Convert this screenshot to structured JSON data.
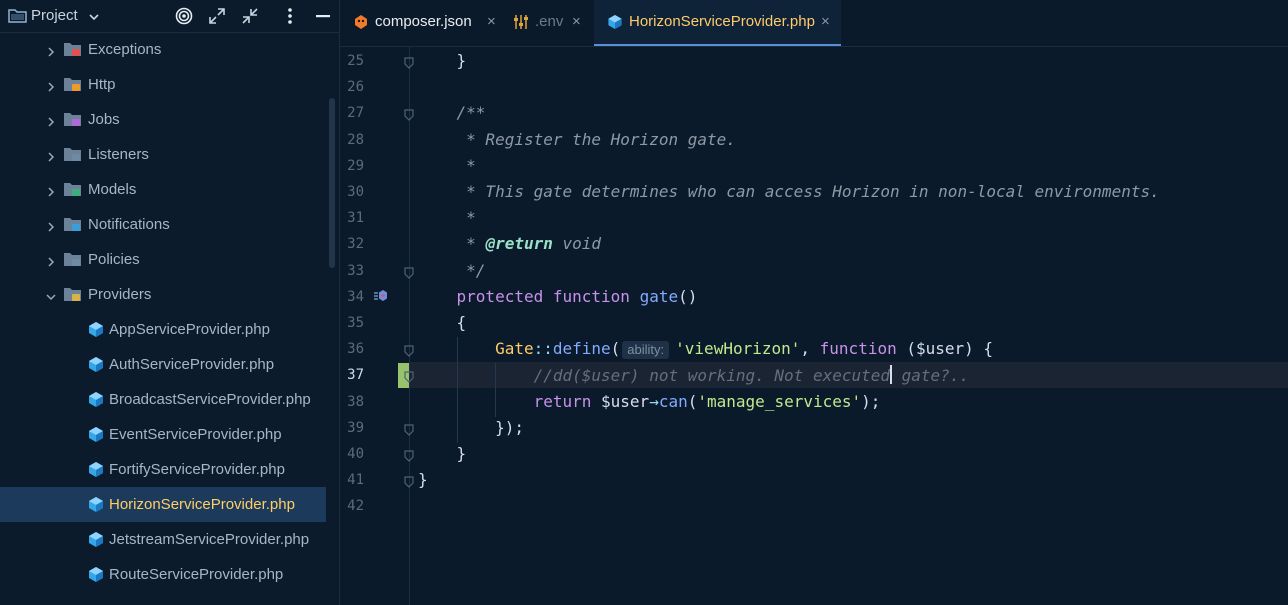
{
  "project_panel": {
    "title": "Project",
    "tree": [
      {
        "label": "Exceptions",
        "type": "folder",
        "color": "#e05252"
      },
      {
        "label": "Http",
        "type": "folder",
        "color": "#f09a2c"
      },
      {
        "label": "Jobs",
        "type": "folder",
        "color": "#b06ad6"
      },
      {
        "label": "Listeners",
        "type": "folder",
        "color": "#6f8aa3"
      },
      {
        "label": "Models",
        "type": "folder",
        "color": "#3fae7e"
      },
      {
        "label": "Notifications",
        "type": "folder",
        "color": "#3a9fd8"
      },
      {
        "label": "Policies",
        "type": "folder",
        "color": "#6f8aa3"
      },
      {
        "label": "Providers",
        "type": "folder-open",
        "color": "#d9b34a"
      },
      {
        "label": "AppServiceProvider.php",
        "type": "php"
      },
      {
        "label": "AuthServiceProvider.php",
        "type": "php"
      },
      {
        "label": "BroadcastServiceProvider.php",
        "type": "php"
      },
      {
        "label": "EventServiceProvider.php",
        "type": "php"
      },
      {
        "label": "FortifyServiceProvider.php",
        "type": "php"
      },
      {
        "label": "HorizonServiceProvider.php",
        "type": "php",
        "selected": true
      },
      {
        "label": "JetstreamServiceProvider.php",
        "type": "php"
      },
      {
        "label": "RouteServiceProvider.php",
        "type": "php"
      }
    ]
  },
  "tabs": [
    {
      "label": "composer.json",
      "icon": "composer-icon",
      "color": "#e8ecf0"
    },
    {
      "label": ".env",
      "icon": "settings-sliders-icon",
      "color": "#6b7b8c"
    },
    {
      "label": "HorizonServiceProvider.php",
      "icon": "php-cube-icon",
      "color": "#ffcb6b",
      "active": true
    }
  ],
  "editor": {
    "current_line": 37,
    "param_hint": "ability:",
    "lines": [
      {
        "n": 25,
        "tokens": [
          [
            "plain",
            "    }"
          ]
        ]
      },
      {
        "n": 26,
        "tokens": []
      },
      {
        "n": 27,
        "tokens": [
          [
            "doc",
            "    /**"
          ]
        ]
      },
      {
        "n": 28,
        "tokens": [
          [
            "doc",
            "     * Register the Horizon gate."
          ]
        ]
      },
      {
        "n": 29,
        "tokens": [
          [
            "doc",
            "     *"
          ]
        ]
      },
      {
        "n": 30,
        "tokens": [
          [
            "doc",
            "     * This gate determines who can access Horizon in non-local environments."
          ]
        ]
      },
      {
        "n": 31,
        "tokens": [
          [
            "doc",
            "     *"
          ]
        ]
      },
      {
        "n": 32,
        "tokens": [
          [
            "doc",
            "     * "
          ],
          [
            "doctag",
            "@return"
          ],
          [
            "doc",
            " void"
          ]
        ]
      },
      {
        "n": 33,
        "tokens": [
          [
            "doc",
            "     */"
          ]
        ]
      },
      {
        "n": 34,
        "tokens": [
          [
            "kw",
            "    protected function "
          ],
          [
            "fn",
            "gate"
          ],
          [
            "plain",
            "()"
          ]
        ]
      },
      {
        "n": 35,
        "tokens": [
          [
            "plain",
            "    {"
          ]
        ]
      },
      {
        "n": 36,
        "tokens": [
          [
            "plain",
            "        "
          ],
          [
            "cls",
            "Gate"
          ],
          [
            "op",
            "::"
          ],
          [
            "fn",
            "define"
          ],
          [
            "plain",
            "("
          ],
          [
            "hint",
            ""
          ],
          [
            "str",
            "'viewHorizon'"
          ],
          [
            "plain",
            ", "
          ],
          [
            "kw",
            "function"
          ],
          [
            "plain",
            " ($user) {"
          ]
        ]
      },
      {
        "n": 37,
        "tokens": [
          [
            "plain",
            "            "
          ],
          [
            "cmt",
            "//dd($user) not working. Not executed"
          ],
          [
            "caret",
            ""
          ],
          [
            "cmt",
            " gate?.."
          ]
        ]
      },
      {
        "n": 38,
        "tokens": [
          [
            "plain",
            "            "
          ],
          [
            "kw",
            "return"
          ],
          [
            "plain",
            " $user"
          ],
          [
            "op",
            "→"
          ],
          [
            "fn",
            "can"
          ],
          [
            "plain",
            "("
          ],
          [
            "str",
            "'manage_services'"
          ],
          [
            "plain",
            ");"
          ]
        ]
      },
      {
        "n": 39,
        "tokens": [
          [
            "plain",
            "        });"
          ]
        ]
      },
      {
        "n": 40,
        "tokens": [
          [
            "plain",
            "    }"
          ]
        ]
      },
      {
        "n": 41,
        "tokens": [
          [
            "plain",
            "}"
          ]
        ]
      },
      {
        "n": 42,
        "tokens": []
      }
    ]
  }
}
